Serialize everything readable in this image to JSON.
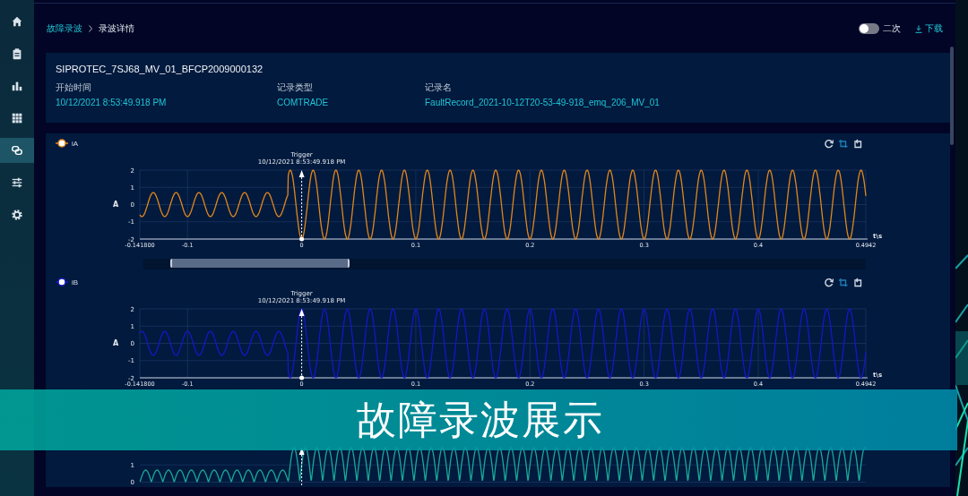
{
  "sidebar": {
    "items": [
      {
        "selected": false
      },
      {
        "selected": false
      },
      {
        "selected": false
      },
      {
        "selected": false
      },
      {
        "selected": true
      },
      {
        "selected": false
      },
      {
        "selected": false
      }
    ]
  },
  "breadcrumb": [
    {
      "label": "故障录波",
      "kind": "link"
    },
    {
      "label": "录波详情",
      "kind": "current"
    }
  ],
  "toggle": {
    "label": "二次",
    "on": false
  },
  "download": {
    "label": "下载"
  },
  "record": {
    "title": "SIPROTEC_7SJ68_MV_01_BFCP2009000132",
    "fields": [
      {
        "label": "开始时间",
        "value": "10/12/2021 8:53:49.918 PM"
      },
      {
        "label": "记录类型",
        "value": "COMTRADE"
      },
      {
        "label": "记录名",
        "value": "FaultRecord_2021-10-12T20-53-49-918_emq_206_MV_01"
      }
    ]
  },
  "charts": [
    {
      "name": "iA",
      "color": "#e0861c",
      "trigger": {
        "label": "Trigger",
        "time": "10/12/2021 8:53:49.918 PM"
      },
      "y_unit": "A",
      "yticks": [
        "2",
        "1",
        "0",
        "-1",
        "-2"
      ],
      "xticks": [
        "-0.141800",
        "-0.1",
        "0",
        "0.1",
        "0.2",
        "0.3",
        "0.4",
        "0.4942"
      ],
      "x_unit": "t\\s",
      "scrollbar": true
    },
    {
      "name": "iB",
      "color": "#1616c8",
      "trigger": {
        "label": "Trigger",
        "time": "10/12/2021 8:53:49.918 PM"
      },
      "y_unit": "A",
      "yticks": [
        "2",
        "1",
        "0",
        "-1",
        "-2"
      ],
      "xticks": [
        "-0.141800",
        "-0.1",
        "0",
        "0.1",
        "0.2",
        "0.3",
        "0.4",
        "0.4942"
      ],
      "x_unit": "t\\s"
    },
    {
      "color": "#1aa89a",
      "yticks": [
        "1",
        "0"
      ]
    }
  ],
  "caption_banner": {
    "text": "故障录波展示"
  }
}
